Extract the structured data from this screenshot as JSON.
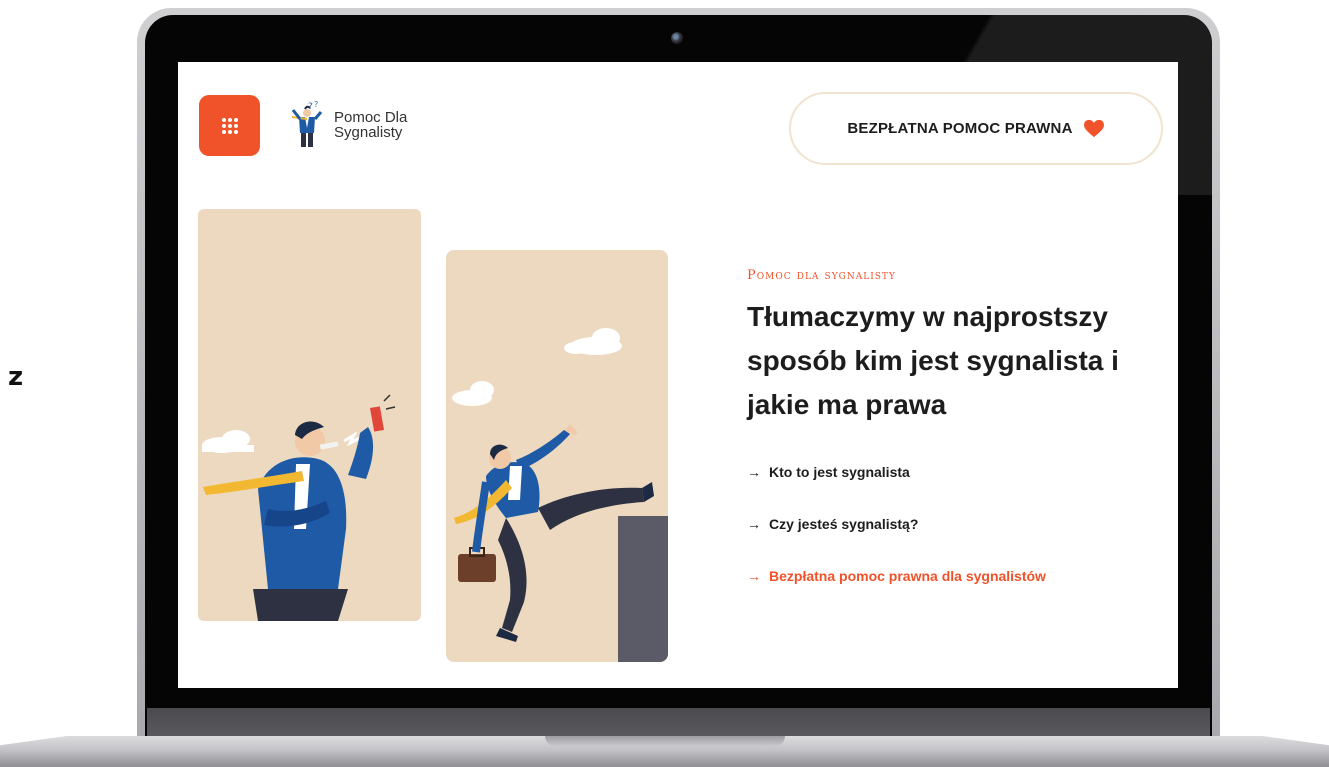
{
  "side_letter": "z",
  "header": {
    "logo_line1": "Pomoc Dla",
    "logo_line2": "Sygnalisty",
    "cta_label": "BEZPŁATNA POMOC PRAWNA"
  },
  "hero": {
    "eyebrow": "Pomoc dla sygnalisty",
    "headline": "Tłumaczymy w najprostszy sposób kim jest sygnalista i jakie ma prawa",
    "links": [
      {
        "label": "Kto to jest sygnalista"
      },
      {
        "label": "Czy jesteś sygnalistą?"
      },
      {
        "label": "Bezpłatna pomoc prawna dla sygnalistów"
      }
    ],
    "arrow": "→"
  },
  "colors": {
    "accent": "#f0532a",
    "panel": "#ecd9bf",
    "cta_border": "#f1e3cf"
  },
  "icons": [
    "menu-grid-icon",
    "heart-icon",
    "arrow-right-icon",
    "whistleblower-logo-icon"
  ]
}
